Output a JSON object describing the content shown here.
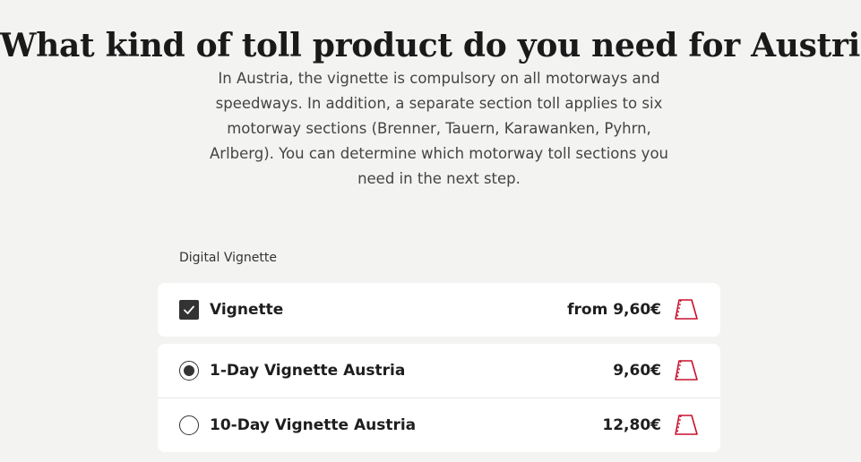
{
  "page": {
    "title": "What kind of toll product do you need for Austria?",
    "intro": "In Austria, the vignette is compulsory on all motorways and speedways. In addition, a separate section toll applies to six motorway sections (Brenner, Tauern, Karawanken, Pyhrn, Arlberg). You can determine which motorway toll sections you need in the next step."
  },
  "section": {
    "label": "Digital Vignette"
  },
  "product": {
    "label": "Vignette",
    "price": "from 9,60€",
    "checked": true,
    "icon": "vignette-icon"
  },
  "options": [
    {
      "label": "1-Day Vignette Austria",
      "price": "9,60€",
      "selected": true,
      "icon": "vignette-icon"
    },
    {
      "label": "10-Day Vignette Austria",
      "price": "12,80€",
      "selected": false,
      "icon": "vignette-icon"
    }
  ],
  "colors": {
    "background": "#f3f3f1",
    "card": "#ffffff",
    "accent": "#c8102e",
    "control": "#333333"
  }
}
